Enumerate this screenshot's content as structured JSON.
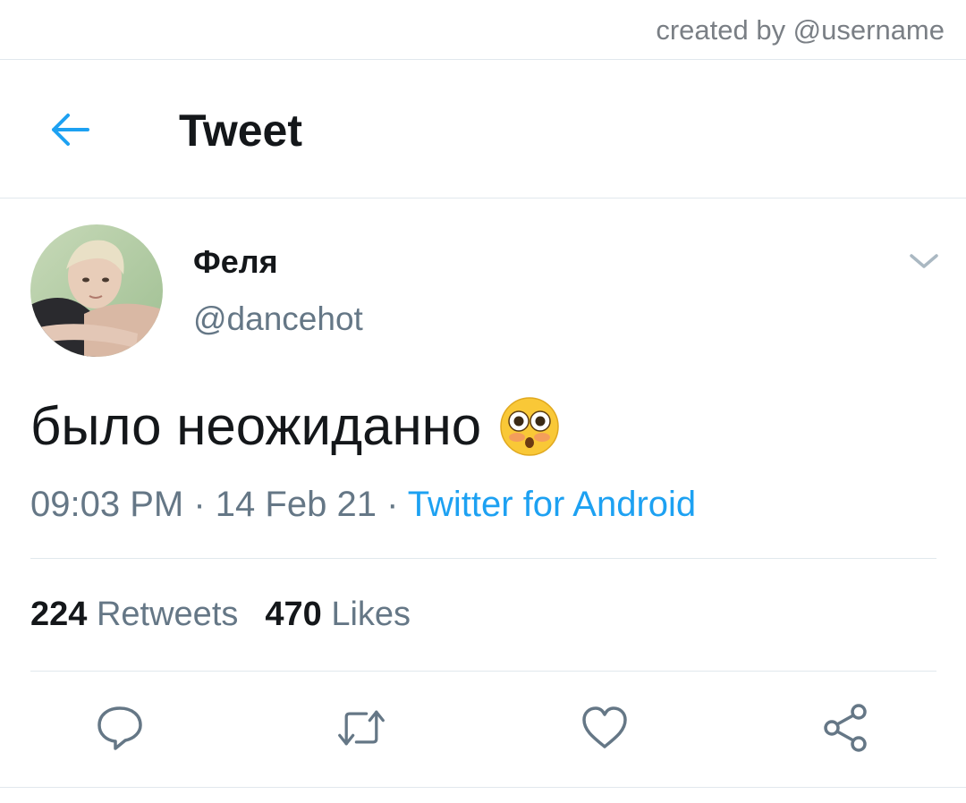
{
  "credit": "created by @username",
  "header": {
    "back_icon": "arrow-left-icon",
    "title": "Tweet"
  },
  "tweet": {
    "display_name": "Феля",
    "handle": "@dancehot",
    "text": "было неожиданно",
    "emoji": "flushed-face",
    "time": "09:03 PM",
    "date": "14 Feb 21",
    "separator": "·",
    "source": "Twitter for Android",
    "retweets_count": "224",
    "retweets_label": "Retweets",
    "likes_count": "470",
    "likes_label": "Likes"
  },
  "actions": [
    {
      "name": "reply",
      "icon": "comment-icon"
    },
    {
      "name": "retweet",
      "icon": "retweet-icon"
    },
    {
      "name": "like",
      "icon": "heart-icon"
    },
    {
      "name": "share",
      "icon": "share-icon"
    }
  ],
  "colors": {
    "accent": "#1da1f2",
    "text": "#14171a",
    "secondary": "#657786",
    "divider": "#e1e8ed"
  }
}
